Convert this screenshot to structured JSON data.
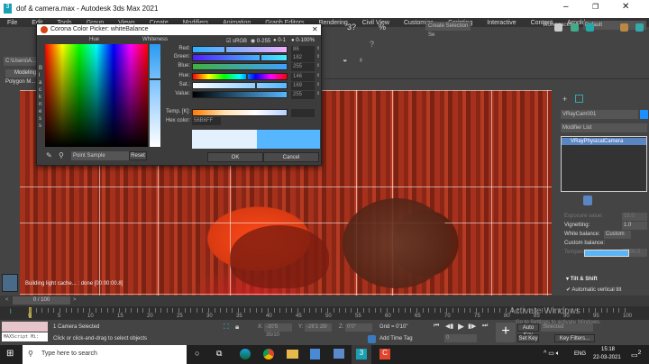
{
  "window": {
    "title": "dof & camera.max - Autodesk 3ds Max 2021"
  },
  "menu": [
    "File",
    "Edit",
    "Tools",
    "Group",
    "Views",
    "Create",
    "Modifiers",
    "Animation",
    "Graph Editors",
    "Rendering",
    "Civil View",
    "Customize",
    "Scripting",
    "Interactive",
    "Content",
    "Arnold"
  ],
  "workspaces": {
    "label": "Workspaces:",
    "value": "Default"
  },
  "toolbar": {
    "selection_set": "Create Selection Se",
    "rb_label": "RB"
  },
  "left_panel": {
    "path": "C:\\Users\\A...",
    "tab_modeling": "Modeling",
    "tab_polygon": "Polygon M..."
  },
  "dialog": {
    "title": "Corona Color Picker: whiteBalance",
    "hue_label": "Hue",
    "whiteness_label": "Whiteness",
    "blackness_label": "Blackness",
    "srgb": "sRGB",
    "modes": [
      "0-255",
      "0-1",
      "0-100%"
    ],
    "channels": [
      {
        "label": "Red:",
        "value": "86",
        "fraction": 0.34
      },
      {
        "label": "Green:",
        "value": "182",
        "fraction": 0.71
      },
      {
        "label": "Blue:",
        "value": "255",
        "fraction": 1.0
      },
      {
        "label": "Hue:",
        "value": "146",
        "fraction": 0.57
      },
      {
        "label": "Sat.:",
        "value": "169",
        "fraction": 0.66
      },
      {
        "label": "Value:",
        "value": "255",
        "fraction": 1.0
      }
    ],
    "temp_label": "Temp. [K]:",
    "hex_label": "Hex color:",
    "hex": "56B6FF",
    "sample_mode": "Point Sample",
    "reset": "Reset",
    "ok": "OK",
    "cancel": "Cancel",
    "old_color": "#e3f1ff",
    "new_color": "#56b6ff"
  },
  "viewport": {
    "label": "[+] [",
    "status": "Building light cache... : done [00:00:00.8]"
  },
  "command_panel": {
    "object_name": "VRayCam001",
    "object_color": "#1e8fff",
    "modifier_list": "Modifier List",
    "stack": [
      "VRayPhysicalCamera"
    ],
    "params": [
      {
        "label": "Exposure value:",
        "value": "15.0"
      },
      {
        "label": "Vignetting:",
        "value": "1.0"
      },
      {
        "label": "White balance:",
        "value": "Custom"
      },
      {
        "label": "Custom balance:",
        "value": ""
      },
      {
        "label": "Temperature (K):",
        "value": "6500.0"
      }
    ],
    "rollout": "Tilt & Shift",
    "auto_tilt": "Automatic vertical tilt"
  },
  "timeline": {
    "frame": "0 / 100",
    "ticks": [
      "0",
      "5",
      "10",
      "15",
      "20",
      "25",
      "30",
      "35",
      "40",
      "45",
      "50",
      "55",
      "60",
      "65",
      "70",
      "75",
      "80",
      "85",
      "90",
      "95",
      "100"
    ]
  },
  "status": {
    "maxscript": "MAXScript Mi:",
    "selection": "1 Camera Selected",
    "prompt": "Click or click-and-drag to select objects",
    "x_label": "X:",
    "x": "-30'5 35/10",
    "y_label": "Y:",
    "y": "-26'1 28/",
    "z_label": "Z:",
    "z": "0'0\"",
    "grid": "Grid = 0'10\"",
    "time_tag": "Add Time Tag",
    "frame_field": "0",
    "auto_key": "Auto Key",
    "selected": "Selected",
    "set_key": "Set Key",
    "key_filters": "Key Filters..."
  },
  "watermark": {
    "line1": "Activate Windows",
    "line2": "Go to Settings to activate Windows."
  },
  "taskbar": {
    "search": "Type here to search",
    "lang": "ENG",
    "time": "15:18",
    "date": "22-03-2021",
    "notif": "2"
  }
}
